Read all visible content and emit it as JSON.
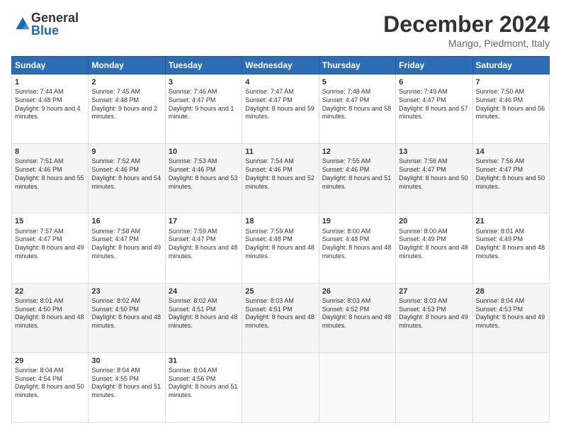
{
  "logo": {
    "general": "General",
    "blue": "Blue"
  },
  "header": {
    "month": "December 2024",
    "location": "Mango, Piedmont, Italy"
  },
  "days_of_week": [
    "Sunday",
    "Monday",
    "Tuesday",
    "Wednesday",
    "Thursday",
    "Friday",
    "Saturday"
  ],
  "weeks": [
    [
      {
        "day": "1",
        "info": "Sunrise: 7:44 AM\nSunset: 4:48 PM\nDaylight: 9 hours and 4 minutes."
      },
      {
        "day": "2",
        "info": "Sunrise: 7:45 AM\nSunset: 4:48 PM\nDaylight: 9 hours and 2 minutes."
      },
      {
        "day": "3",
        "info": "Sunrise: 7:46 AM\nSunset: 4:47 PM\nDaylight: 9 hours and 1 minute."
      },
      {
        "day": "4",
        "info": "Sunrise: 7:47 AM\nSunset: 4:47 PM\nDaylight: 8 hours and 59 minutes."
      },
      {
        "day": "5",
        "info": "Sunrise: 7:48 AM\nSunset: 4:47 PM\nDaylight: 8 hours and 58 minutes."
      },
      {
        "day": "6",
        "info": "Sunrise: 7:49 AM\nSunset: 4:47 PM\nDaylight: 8 hours and 57 minutes."
      },
      {
        "day": "7",
        "info": "Sunrise: 7:50 AM\nSunset: 4:46 PM\nDaylight: 8 hours and 56 minutes."
      }
    ],
    [
      {
        "day": "8",
        "info": "Sunrise: 7:51 AM\nSunset: 4:46 PM\nDaylight: 8 hours and 55 minutes."
      },
      {
        "day": "9",
        "info": "Sunrise: 7:52 AM\nSunset: 4:46 PM\nDaylight: 8 hours and 54 minutes."
      },
      {
        "day": "10",
        "info": "Sunrise: 7:53 AM\nSunset: 4:46 PM\nDaylight: 8 hours and 53 minutes."
      },
      {
        "day": "11",
        "info": "Sunrise: 7:54 AM\nSunset: 4:46 PM\nDaylight: 8 hours and 52 minutes."
      },
      {
        "day": "12",
        "info": "Sunrise: 7:55 AM\nSunset: 4:46 PM\nDaylight: 8 hours and 51 minutes."
      },
      {
        "day": "13",
        "info": "Sunrise: 7:56 AM\nSunset: 4:47 PM\nDaylight: 8 hours and 50 minutes."
      },
      {
        "day": "14",
        "info": "Sunrise: 7:56 AM\nSunset: 4:47 PM\nDaylight: 8 hours and 50 minutes."
      }
    ],
    [
      {
        "day": "15",
        "info": "Sunrise: 7:57 AM\nSunset: 4:47 PM\nDaylight: 8 hours and 49 minutes."
      },
      {
        "day": "16",
        "info": "Sunrise: 7:58 AM\nSunset: 4:47 PM\nDaylight: 8 hours and 49 minutes."
      },
      {
        "day": "17",
        "info": "Sunrise: 7:59 AM\nSunset: 4:47 PM\nDaylight: 8 hours and 48 minutes."
      },
      {
        "day": "18",
        "info": "Sunrise: 7:59 AM\nSunset: 4:48 PM\nDaylight: 8 hours and 48 minutes."
      },
      {
        "day": "19",
        "info": "Sunrise: 8:00 AM\nSunset: 4:48 PM\nDaylight: 8 hours and 48 minutes."
      },
      {
        "day": "20",
        "info": "Sunrise: 8:00 AM\nSunset: 4:49 PM\nDaylight: 8 hours and 48 minutes."
      },
      {
        "day": "21",
        "info": "Sunrise: 8:01 AM\nSunset: 4:49 PM\nDaylight: 8 hours and 48 minutes."
      }
    ],
    [
      {
        "day": "22",
        "info": "Sunrise: 8:01 AM\nSunset: 4:50 PM\nDaylight: 8 hours and 48 minutes."
      },
      {
        "day": "23",
        "info": "Sunrise: 8:02 AM\nSunset: 4:50 PM\nDaylight: 8 hours and 48 minutes."
      },
      {
        "day": "24",
        "info": "Sunrise: 8:02 AM\nSunset: 4:51 PM\nDaylight: 8 hours and 48 minutes."
      },
      {
        "day": "25",
        "info": "Sunrise: 8:03 AM\nSunset: 4:51 PM\nDaylight: 8 hours and 48 minutes."
      },
      {
        "day": "26",
        "info": "Sunrise: 8:03 AM\nSunset: 4:52 PM\nDaylight: 8 hours and 48 minutes."
      },
      {
        "day": "27",
        "info": "Sunrise: 8:03 AM\nSunset: 4:53 PM\nDaylight: 8 hours and 49 minutes."
      },
      {
        "day": "28",
        "info": "Sunrise: 8:04 AM\nSunset: 4:53 PM\nDaylight: 8 hours and 49 minutes."
      }
    ],
    [
      {
        "day": "29",
        "info": "Sunrise: 8:04 AM\nSunset: 4:54 PM\nDaylight: 8 hours and 50 minutes."
      },
      {
        "day": "30",
        "info": "Sunrise: 8:04 AM\nSunset: 4:55 PM\nDaylight: 8 hours and 51 minutes."
      },
      {
        "day": "31",
        "info": "Sunrise: 8:04 AM\nSunset: 4:56 PM\nDaylight: 8 hours and 51 minutes."
      },
      {
        "day": "",
        "info": ""
      },
      {
        "day": "",
        "info": ""
      },
      {
        "day": "",
        "info": ""
      },
      {
        "day": "",
        "info": ""
      }
    ]
  ]
}
